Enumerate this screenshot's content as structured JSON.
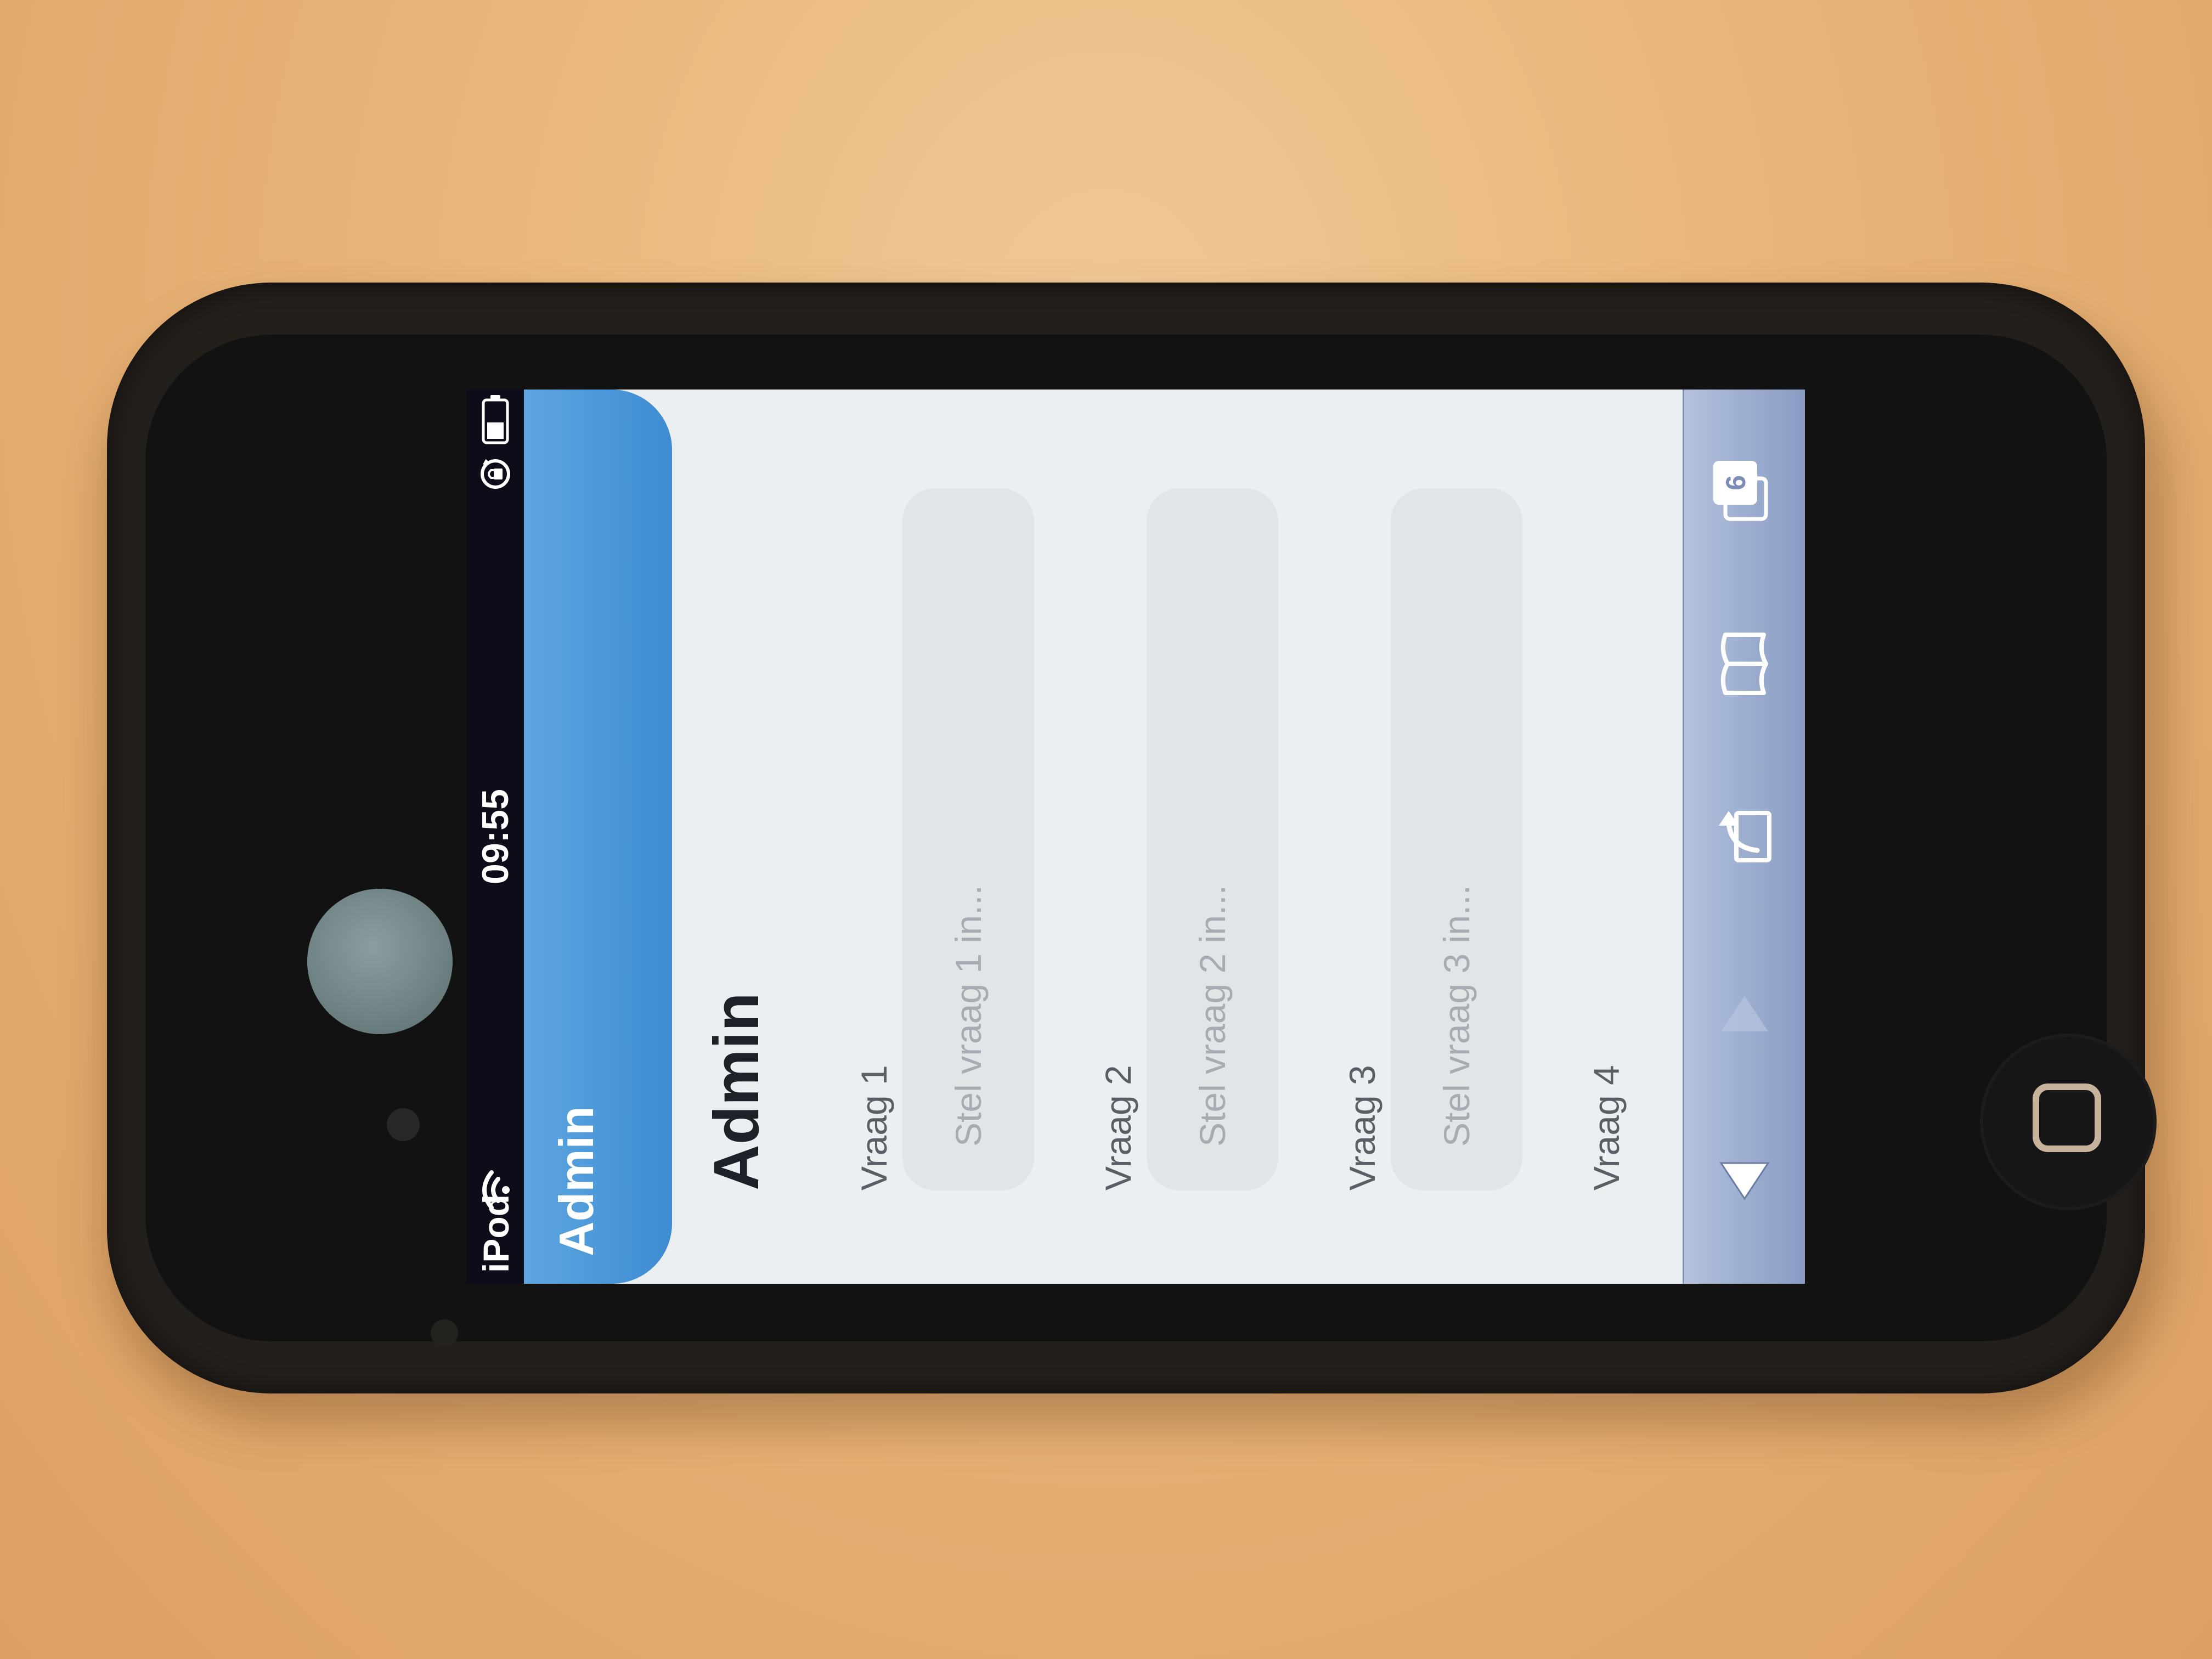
{
  "status_bar": {
    "carrier": "iPod",
    "time": "09:55",
    "wifi_icon": "wifi-icon",
    "lock_icon": "rotation-lock-icon",
    "battery_icon": "battery-icon"
  },
  "nav_bar": {
    "title": "Admin"
  },
  "page": {
    "heading": "Admin",
    "questions": [
      {
        "label": "Vraag 1",
        "placeholder": "Stel vraag 1 in..."
      },
      {
        "label": "Vraag 2",
        "placeholder": "Stel vraag 2 in..."
      },
      {
        "label": "Vraag 3",
        "placeholder": "Stel vraag 3 in..."
      },
      {
        "label": "Vraag 4"
      }
    ]
  },
  "toolbar": {
    "buttons": [
      "back-arrow-icon",
      "forward-arrow-icon",
      "share-icon",
      "bookmarks-icon",
      "tabs-icon"
    ],
    "tab_count": "6"
  },
  "colors": {
    "nav_blue": "#3d8bd2",
    "page_background": "#eceff1",
    "toolbar": "#9fb0d1",
    "status_bar": "#0d0d1a"
  }
}
